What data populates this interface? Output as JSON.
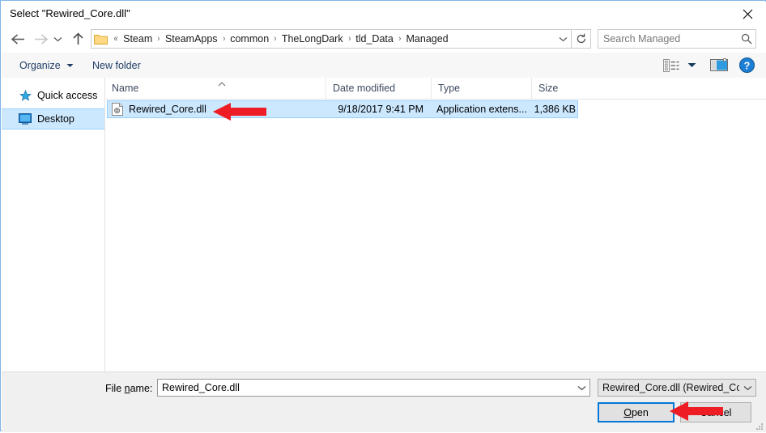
{
  "window": {
    "title": "Select \"Rewired_Core.dll\"",
    "close_label": "✕"
  },
  "nav": {
    "back_icon": "back-arrow-icon",
    "forward_icon": "forward-arrow-icon",
    "recent_icon": "recent-locations-chevron-icon",
    "up_icon": "up-arrow-icon",
    "breadcrumb_prefix": "«",
    "breadcrumbs": [
      "Steam",
      "SteamApps",
      "common",
      "TheLongDark",
      "tld_Data",
      "Managed"
    ],
    "separator": "›",
    "refresh_icon": "refresh-icon"
  },
  "search": {
    "placeholder": "Search Managed",
    "value": "",
    "icon": "search-icon"
  },
  "toolbar": {
    "organize_label": "Organize",
    "new_folder_label": "New folder",
    "view_mode_icon": "view-mode-icon",
    "preview_pane_icon": "preview-pane-icon",
    "help_icon": "help-icon",
    "help_glyph": "?"
  },
  "navpane": {
    "items": [
      {
        "label": "Quick access",
        "icon": "star-icon",
        "selected": false
      },
      {
        "label": "Desktop",
        "icon": "desktop-monitor-icon",
        "selected": true
      }
    ]
  },
  "filelist": {
    "columns": [
      {
        "label": "Name"
      },
      {
        "label": "Date modified"
      },
      {
        "label": "Type"
      },
      {
        "label": "Size"
      }
    ],
    "sort_indicator": "ascending",
    "rows": [
      {
        "name": "Rewired_Core.dll",
        "date_modified": "9/18/2017 9:41 PM",
        "type": "Application extens...",
        "size": "1,386 KB",
        "icon": "dll-file-icon",
        "selected": true
      }
    ]
  },
  "footer": {
    "filename_label_pre": "File ",
    "filename_label_accel": "n",
    "filename_label_post": "ame:",
    "filename_value": "Rewired_Core.dll",
    "filename_placeholder": "File name",
    "filter_value": "Rewired_Core.dll (Rewired_Core",
    "open_label_accel": "O",
    "open_label_post": "pen",
    "cancel_label": "Cancel"
  },
  "annotations": {
    "arrow_color": "#ee1c24",
    "arrow_file_row": "red-left-arrow-pointing-at-file",
    "arrow_open_button": "red-left-arrow-pointing-at-open-button"
  },
  "colors": {
    "accent": "#0078d7",
    "selection": "#cce8ff",
    "selection_border": "#99d1ff",
    "window_border": "#7eb4e8",
    "panel": "#f0f0f0",
    "command_bar": "#f7f7f7",
    "link_text": "#1f3c66"
  }
}
